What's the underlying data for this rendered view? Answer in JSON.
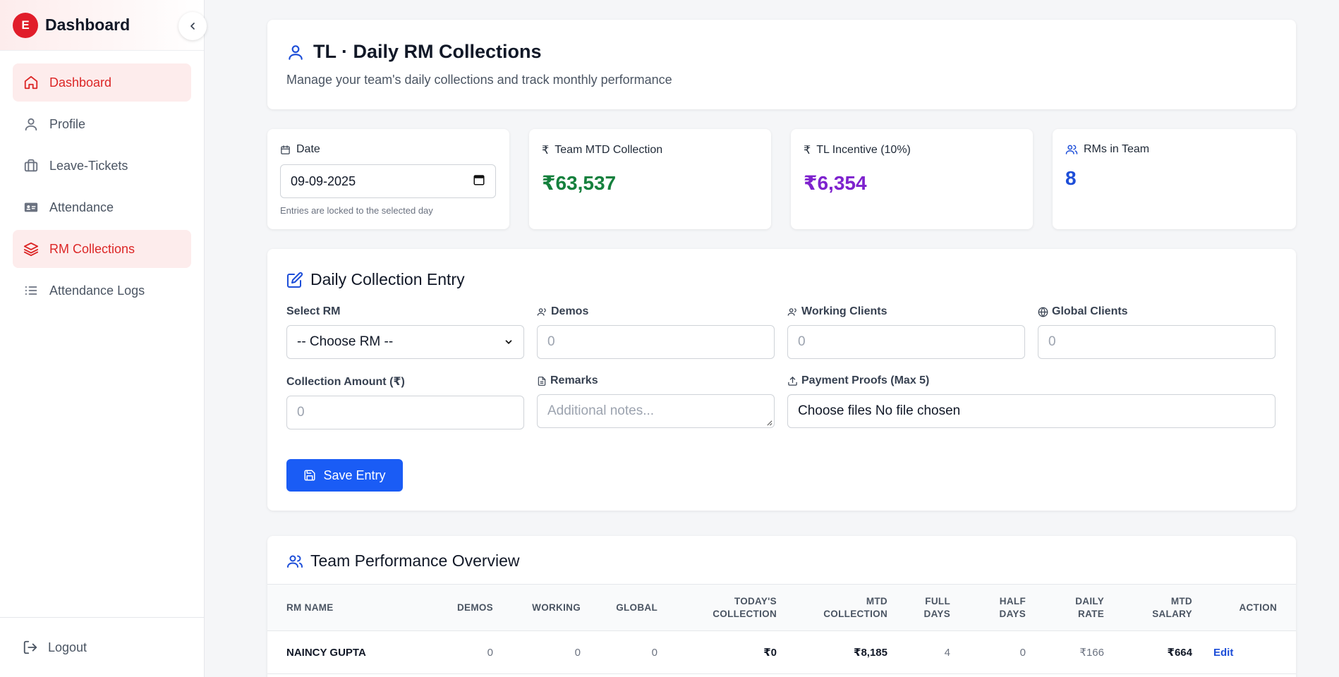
{
  "sidebar": {
    "logo_letter": "E",
    "brand": "Dashboard",
    "items": [
      {
        "label": "Dashboard",
        "icon": "home-icon",
        "active": true
      },
      {
        "label": "Profile",
        "icon": "user-icon",
        "active": false
      },
      {
        "label": "Leave-Tickets",
        "icon": "briefcase-icon",
        "active": false
      },
      {
        "label": "Attendance",
        "icon": "id-card-icon",
        "active": false
      },
      {
        "label": "RM Collections",
        "icon": "layers-icon",
        "active": true
      },
      {
        "label": "Attendance Logs",
        "icon": "list-icon",
        "active": false
      }
    ],
    "logout_label": "Logout"
  },
  "header": {
    "title": "TL · Daily RM Collections",
    "subtitle": "Manage your team's daily collections and track monthly performance"
  },
  "stats": {
    "date_label": "Date",
    "date_value": "09-09-2025",
    "date_hint": "Entries are locked to the selected day",
    "mtd_label": "Team MTD Collection",
    "mtd_value": "₹63,537",
    "incentive_label": "TL Incentive (10%)",
    "incentive_value": "₹6,354",
    "rms_label": "RMs in Team",
    "rms_value": "8"
  },
  "entry": {
    "title": "Daily Collection Entry",
    "select_rm_label": "Select RM",
    "select_rm_value": "-- Choose RM --",
    "demos_label": "Demos",
    "demos_placeholder": "0",
    "working_label": "Working Clients",
    "working_placeholder": "0",
    "global_label": "Global Clients",
    "global_placeholder": "0",
    "amount_label": "Collection Amount (₹)",
    "amount_placeholder": "0",
    "remarks_label": "Remarks",
    "remarks_placeholder": "Additional notes...",
    "proofs_label": "Payment Proofs (Max 5)",
    "proofs_value": "Choose files No file chosen",
    "save_label": "Save Entry"
  },
  "performance": {
    "title": "Team Performance Overview",
    "columns": [
      [
        "RM NAME"
      ],
      [
        "DEMOS"
      ],
      [
        "WORKING"
      ],
      [
        "GLOBAL"
      ],
      [
        "TODAY'S",
        "COLLECTION"
      ],
      [
        "MTD",
        "COLLECTION"
      ],
      [
        "FULL",
        "DAYS"
      ],
      [
        "HALF",
        "DAYS"
      ],
      [
        "DAILY",
        "RATE"
      ],
      [
        "MTD",
        "SALARY"
      ],
      [
        "ACTION"
      ]
    ],
    "rows": [
      {
        "name": "NAINCY GUPTA",
        "demos": "0",
        "working": "0",
        "global": "0",
        "today": "₹0",
        "mtd": "₹8,185",
        "full": "4",
        "half": "0",
        "rate": "₹166",
        "salary": "₹664",
        "action": "Edit"
      }
    ]
  },
  "colors": {
    "accent": "#dc2626",
    "primary": "#1a5cf5",
    "green": "#15803d",
    "purple": "#7e22ce",
    "blue": "#1d4ed8"
  }
}
